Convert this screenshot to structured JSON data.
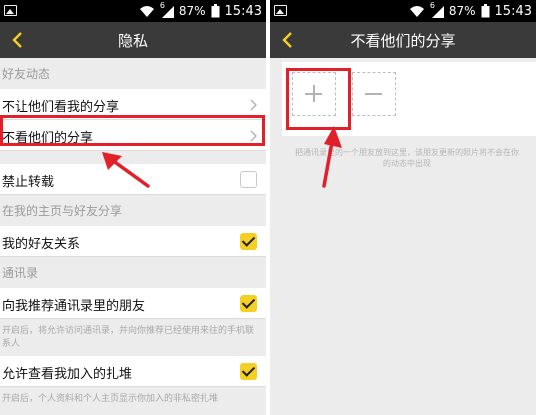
{
  "left_screen": {
    "status": {
      "battery_percent": "87%",
      "time": "15:43",
      "signal_label": "6"
    },
    "title": "隐私",
    "sections": [
      {
        "header": "好友动态"
      },
      {
        "header": "在我的主页与好友分享"
      },
      {
        "header": "通讯录"
      }
    ],
    "rows": {
      "dont_let_see": "不让他们看我的分享",
      "dont_see_theirs": "不看他们的分享",
      "no_repost": "禁止转载",
      "my_friend_relation": "我的好友关系",
      "recommend_contacts": "向我推荐通讯录里的朋友",
      "allow_view_groups": "允许查看我加入的扎堆"
    },
    "checkbox_states": {
      "no_repost": false,
      "my_friend_relation": true,
      "recommend_contacts": true,
      "allow_view_groups": true
    },
    "descriptions": {
      "recommend_contacts": "开启后，将允许访问通讯录，并向你推荐已经使用来往的手机联系人",
      "allow_view_groups": "开启后，个人资料和个人主页显示你加入的非私密扎堆"
    }
  },
  "right_screen": {
    "status": {
      "battery_percent": "87%",
      "time": "15:43",
      "signal_label": "6"
    },
    "title": "不看他们的分享",
    "hint": "把通讯录里的一个朋友放到这里，该朋友更新的照片将不会在你的动态中出现"
  },
  "colors": {
    "accent_yellow": "#f5d024",
    "highlight_red": "#e1202a",
    "title_bar": "#3a3a3a",
    "background": "#ececec"
  },
  "icons": [
    "image-icon",
    "wifi-icon",
    "signal-icon",
    "battery-icon",
    "back-arrow-icon",
    "chevron-right-icon",
    "checkbox-icon",
    "plus-icon",
    "minus-icon"
  ]
}
